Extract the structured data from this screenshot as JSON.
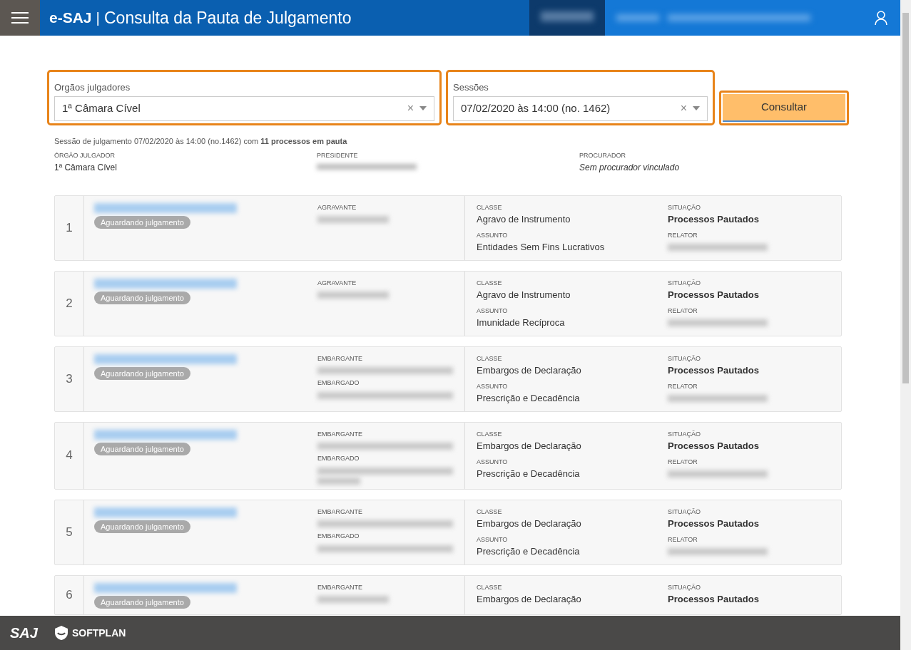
{
  "header": {
    "brand": "e-SAJ",
    "separator": "|",
    "title": "Consulta da Pauta de Julgamento"
  },
  "filters": [
    {
      "label": "Orgãos julgadores",
      "value": "1ª Câmara Cível",
      "clear": "×"
    },
    {
      "label": "Sessões",
      "value": "07/02/2020 às 14:00 (no. 1462)",
      "clear": "×"
    }
  ],
  "search_button": "Consultar",
  "summary": "Sessão de julgamento 07/02/2020 às 14:00 (no.1462) com **11 processos em pauta**",
  "session_info": [
    {
      "label": "ÓRGÃO JULGADOR",
      "value": "1ª Câmara Cível",
      "italic": false
    },
    {
      "label": "PRESIDENTE"
    },
    {
      "label": "PROCURADOR",
      "value": "Sem procurador vinculado",
      "italic": true
    }
  ],
  "rows": [
    {
      "number": "1",
      "badge": "Aguardando julgamento",
      "parties": [
        "AGRAVANTE"
      ],
      "fields": [
        {
          "label": "CLASSE",
          "value": "Agravo de Instrumento"
        },
        {
          "label": "SITUAÇÃO",
          "value": "Processos Pautados",
          "bold": true
        },
        {
          "label": "ASSUNTO",
          "value": "Entidades Sem Fins Lucrativos"
        },
        {
          "label": "RELATOR"
        }
      ]
    },
    {
      "number": "2",
      "badge": "Aguardando julgamento",
      "parties": [
        "AGRAVANTE"
      ],
      "fields": [
        {
          "label": "CLASSE",
          "value": "Agravo de Instrumento"
        },
        {
          "label": "SITUAÇÃO",
          "value": "Processos Pautados",
          "bold": true
        },
        {
          "label": "ASSUNTO",
          "value": "Imunidade Recíproca"
        },
        {
          "label": "RELATOR"
        }
      ]
    },
    {
      "number": "3",
      "badge": "Aguardando julgamento",
      "parties": [
        "EMBARGANTE",
        "EMBARGADO"
      ],
      "fields": [
        {
          "label": "CLASSE",
          "value": "Embargos de Declaração"
        },
        {
          "label": "SITUAÇÃO",
          "value": "Processos Pautados",
          "bold": true
        },
        {
          "label": "ASSUNTO",
          "value": "Prescrição e Decadência"
        },
        {
          "label": "RELATOR"
        }
      ]
    },
    {
      "number": "4",
      "badge": "Aguardando julgamento",
      "parties": [
        "EMBARGANTE",
        "EMBARGADO"
      ],
      "tall": true,
      "fields": [
        {
          "label": "CLASSE",
          "value": "Embargos de Declaração"
        },
        {
          "label": "SITUAÇÃO",
          "value": "Processos Pautados",
          "bold": true
        },
        {
          "label": "ASSUNTO",
          "value": "Prescrição e Decadência"
        },
        {
          "label": "RELATOR"
        }
      ]
    },
    {
      "number": "5",
      "badge": "Aguardando julgamento",
      "parties": [
        "EMBARGANTE",
        "EMBARGADO"
      ],
      "fields": [
        {
          "label": "CLASSE",
          "value": "Embargos de Declaração"
        },
        {
          "label": "SITUAÇÃO",
          "value": "Processos Pautados",
          "bold": true
        },
        {
          "label": "ASSUNTO",
          "value": "Prescrição e Decadência"
        },
        {
          "label": "RELATOR"
        }
      ]
    },
    {
      "number": "6",
      "badge": "Aguardando julgamento",
      "parties": [
        "EMBARGANTE"
      ],
      "fields": [
        {
          "label": "CLASSE",
          "value": "Embargos de Declaração"
        },
        {
          "label": "SITUAÇÃO",
          "value": "Processos Pautados",
          "bold": true
        }
      ]
    }
  ],
  "footer": {
    "saj_logo": "SAJ",
    "softplan_logo": "SOFTPLAN"
  }
}
